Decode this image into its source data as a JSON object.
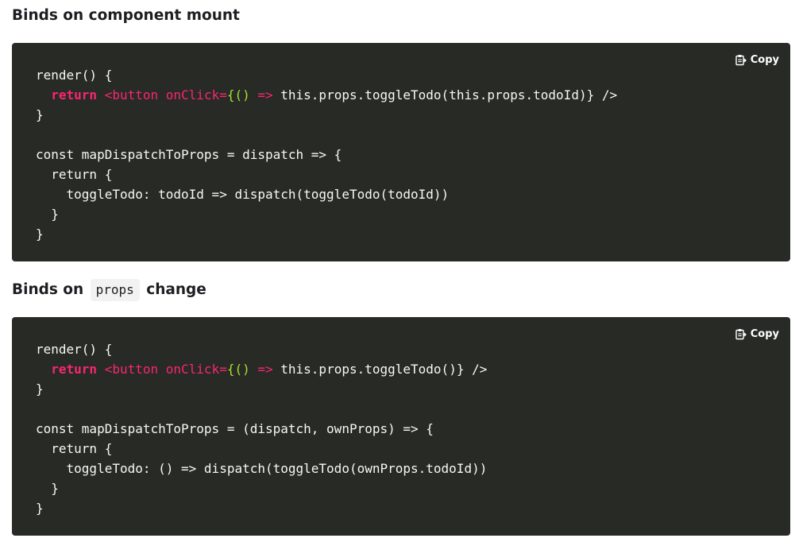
{
  "sections": [
    {
      "heading_prefix": "Binds on component mount",
      "heading_code": "",
      "heading_suffix": "",
      "copy_label": "Copy",
      "code_lines": [
        [
          "render() {"
        ],
        [
          "  ",
          "return",
          " ",
          "<button onClick=",
          "{",
          "()",
          " => ",
          "this.props.toggleTodo(this.props.todoId)} />"
        ],
        [
          "}"
        ],
        [
          ""
        ],
        [
          "const mapDispatchToProps = dispatch => {"
        ],
        [
          "  return {"
        ],
        [
          "    toggleTodo: todoId => dispatch(toggleTodo(todoId))"
        ],
        [
          "  }"
        ],
        [
          "}"
        ]
      ]
    },
    {
      "heading_prefix": "Binds on",
      "heading_code": "props",
      "heading_suffix": "change",
      "copy_label": "Copy",
      "code_lines": [
        [
          "render() {"
        ],
        [
          "  ",
          "return",
          " ",
          "<button onClick=",
          "{",
          "()",
          " => ",
          "this.props.toggleTodo()} />"
        ],
        [
          "}"
        ],
        [
          ""
        ],
        [
          "const mapDispatchToProps = (dispatch, ownProps) => {"
        ],
        [
          "  return {"
        ],
        [
          "    toggleTodo: () => dispatch(toggleTodo(ownProps.todoId))"
        ],
        [
          "  }"
        ],
        [
          "}"
        ]
      ]
    }
  ],
  "colors": {
    "code_background": "#282a25",
    "keyword": "#f92672",
    "jsx_brace": "#a6e22e",
    "plain_text": "#f8f8f2"
  },
  "icons": {
    "copy": "clipboard-icon"
  }
}
